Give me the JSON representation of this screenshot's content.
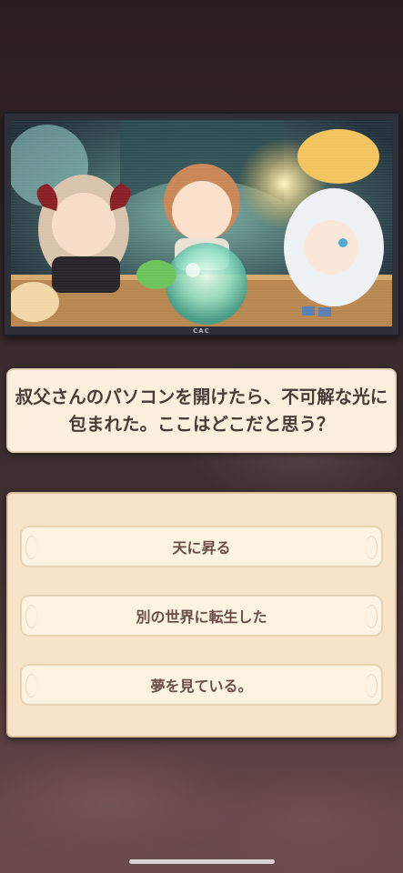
{
  "monitor": {
    "brand": "CAC",
    "scene": "illustration of chibi characters gathered around a glowing crystal ball"
  },
  "question": {
    "text": "叔父さんのパソコンを開けたら、不可解な光に包まれた。ここはどこだと思う？"
  },
  "choices": [
    {
      "label": "天に昇る"
    },
    {
      "label": "別の世界に転生した"
    },
    {
      "label": "夢を見ている。"
    }
  ],
  "colors": {
    "panel": "#f6e3c8",
    "choice_bg": "#fdf3e1",
    "text_dark": "#4a3b36",
    "choice_text": "#6a4d48",
    "background": "#3e2f31"
  }
}
